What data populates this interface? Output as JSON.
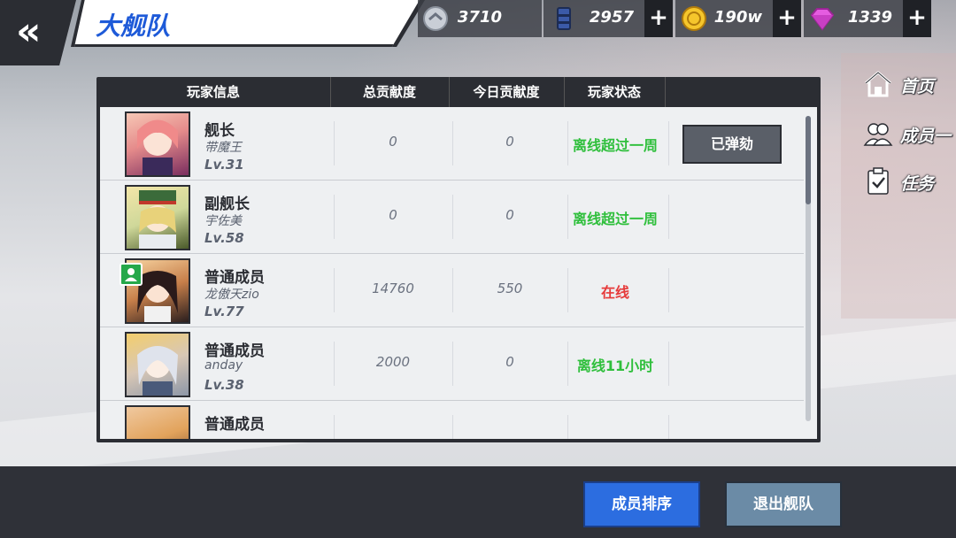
{
  "header": {
    "back_icon": "double-chevron-left-icon",
    "title": "大舰队"
  },
  "currencies": [
    {
      "icon": "silver-coin-icon",
      "value": "3710",
      "has_plus": false
    },
    {
      "icon": "oil-barrel-icon",
      "value": "2957",
      "has_plus": true
    },
    {
      "icon": "gold-coin-icon",
      "value": "190w",
      "has_plus": true
    },
    {
      "icon": "gem-icon",
      "value": "1339",
      "has_plus": true
    }
  ],
  "table": {
    "headers": [
      "玩家信息",
      "总贡献度",
      "今日贡献度",
      "玩家状态"
    ],
    "rows": [
      {
        "rank": "舰长",
        "name": "带魔王",
        "level": "Lv.31",
        "total": "0",
        "today": "0",
        "status": "离线超过一周",
        "status_type": "offline",
        "action": "已弹劾",
        "online_badge": false
      },
      {
        "rank": "副舰长",
        "name": "宇佐美",
        "level": "Lv.58",
        "total": "0",
        "today": "0",
        "status": "离线超过一周",
        "status_type": "offline",
        "action": "",
        "online_badge": false
      },
      {
        "rank": "普通成员",
        "name": "龙傲天zio",
        "level": "Lv.77",
        "total": "14760",
        "today": "550",
        "status": "在线",
        "status_type": "online",
        "action": "",
        "online_badge": true
      },
      {
        "rank": "普通成员",
        "name": "anday",
        "level": "Lv.38",
        "total": "2000",
        "today": "0",
        "status": "离线11小时",
        "status_type": "offline",
        "action": "",
        "online_badge": false
      },
      {
        "rank": "普通成员",
        "name": "",
        "level": "",
        "total": "",
        "today": "",
        "status": "",
        "status_type": "offline",
        "action": "",
        "online_badge": false
      }
    ]
  },
  "side_nav": [
    {
      "icon": "home-icon",
      "label": "首页"
    },
    {
      "icon": "members-icon",
      "label": "成员一"
    },
    {
      "icon": "clipboard-check-icon",
      "label": "任务"
    }
  ],
  "bottom": {
    "sort_label": "成员排序",
    "exit_label": "退出舰队"
  },
  "colors": {
    "offline": "#2fbf3c",
    "online": "#e63b3b",
    "accent": "#2c6de0",
    "title": "#1e5ad8"
  }
}
